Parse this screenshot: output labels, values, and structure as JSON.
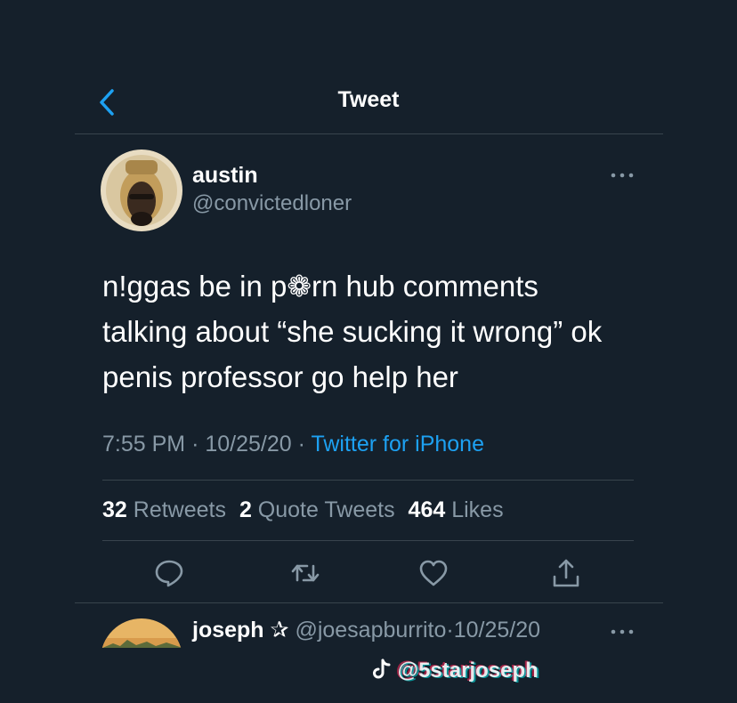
{
  "header": {
    "title": "Tweet",
    "back_icon": "chevron-left-icon"
  },
  "colors": {
    "background": "#15202b",
    "divider": "#38444d",
    "text_primary": "#ffffff",
    "text_secondary": "#8899a6",
    "accent": "#1da1f2"
  },
  "tweet": {
    "author": {
      "name": "austin",
      "handle": "@convictedloner"
    },
    "text_lines": [
      "n!ggas be in p❁rn hub comments",
      "talking about “she sucking it wrong” ok",
      "penis professor go help her"
    ],
    "time": "7:55 PM",
    "date": "10/25/20",
    "separator": "·",
    "source": "Twitter for iPhone",
    "stats": {
      "retweets_count": "32",
      "retweets_label": "Retweets",
      "quotes_count": "2",
      "quotes_label": "Quote Tweets",
      "likes_count": "464",
      "likes_label": "Likes"
    },
    "actions": [
      "reply-icon",
      "retweet-icon",
      "like-icon",
      "share-icon"
    ]
  },
  "reply": {
    "name": "joseph",
    "star": "✰",
    "handle": "@joesapburrito",
    "separator": "·",
    "date": "10/25/20"
  },
  "watermark": {
    "text": "@5starjoseph"
  }
}
